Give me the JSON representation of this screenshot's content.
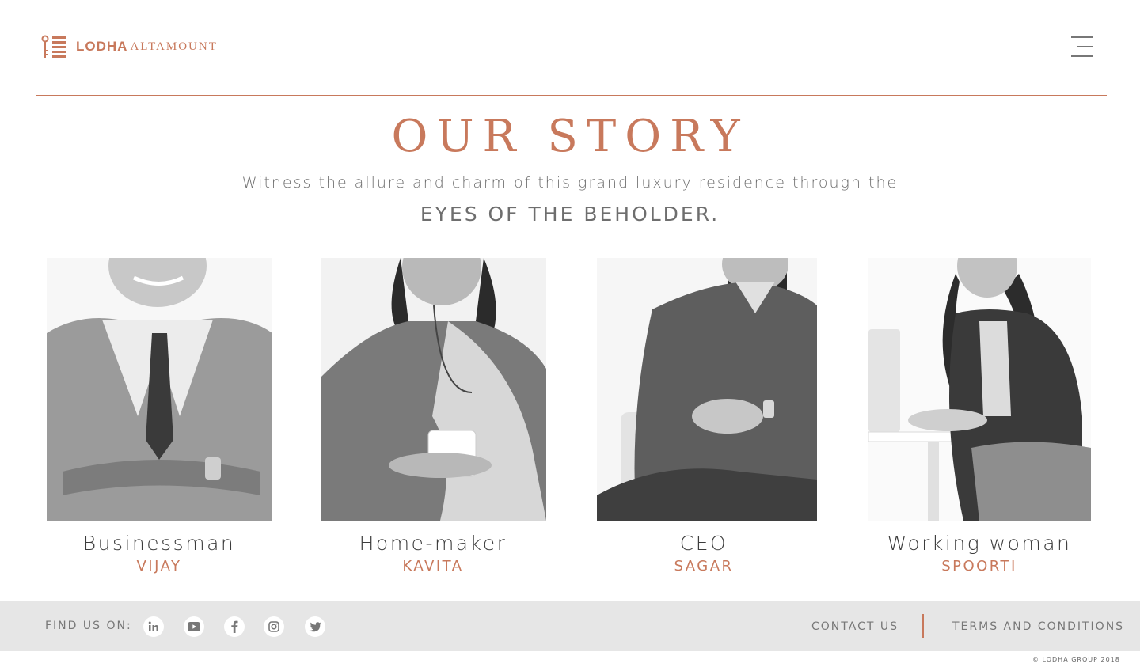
{
  "brand": {
    "name": "LODHA",
    "project": "ALTAMOUNT"
  },
  "page": {
    "title": "OUR STORY",
    "subtitle": "Witness the allure and charm of this grand luxury residence through the",
    "tagline": "EYES OF THE BEHOLDER."
  },
  "people": [
    {
      "role": "Businessman",
      "name": "VIJAY"
    },
    {
      "role": "Home-maker",
      "name": "KAVITA"
    },
    {
      "role": "CEO",
      "name": "SAGAR"
    },
    {
      "role": "Working woman",
      "name": "SPOORTI"
    }
  ],
  "footer": {
    "find_us": "FIND US ON:",
    "social_icons": [
      "linkedin-icon",
      "youtube-icon",
      "facebook-icon",
      "instagram-icon",
      "twitter-icon"
    ],
    "contact": "CONTACT US",
    "terms": "TERMS AND CONDITIONS",
    "copyright": "© LODHA GROUP 2018"
  },
  "colors": {
    "accent": "#c8795c",
    "footer_bg": "#e6e6e6",
    "text": "#6e6e6e"
  }
}
